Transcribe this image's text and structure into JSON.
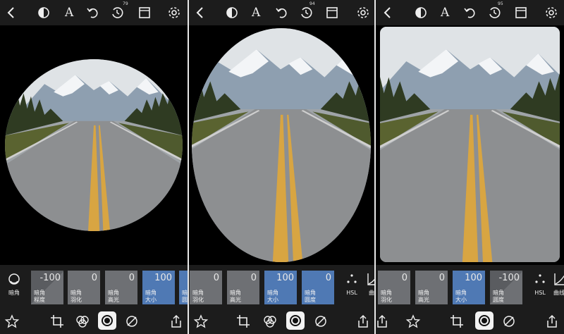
{
  "panels": [
    {
      "badge": "79",
      "text_tool": "A",
      "tiles": [
        {
          "value": "-100",
          "label1": "暗角",
          "label2": "程度"
        },
        {
          "value": "0",
          "label1": "暗角",
          "label2": "羽化"
        },
        {
          "value": "0",
          "label1": "暗角",
          "label2": "高光"
        },
        {
          "value": "100",
          "label1": "暗角",
          "label2": "大小"
        },
        {
          "value": "",
          "label1": "暗",
          "label2": "圆"
        }
      ],
      "tool_label": "暗角"
    },
    {
      "badge": "94",
      "text_tool": "A",
      "tiles": [
        {
          "value": "0",
          "label1": "暗角",
          "label2": "羽化"
        },
        {
          "value": "0",
          "label1": "暗角",
          "label2": "高光"
        },
        {
          "value": "100",
          "label1": "暗角",
          "label2": "大小"
        },
        {
          "value": "0",
          "label1": "暗角",
          "label2": "圆度"
        }
      ],
      "tool_label": "HSL",
      "tool_label2": "曲"
    },
    {
      "badge": "95",
      "text_tool": "A",
      "tiles": [
        {
          "value": "0",
          "label1": "暗角",
          "label2": "羽化"
        },
        {
          "value": "0",
          "label1": "暗角",
          "label2": "高光"
        },
        {
          "value": "100",
          "label1": "暗角",
          "label2": "大小"
        },
        {
          "value": "-100",
          "label1": "暗角",
          "label2": "圆度"
        }
      ],
      "tool_label": "HSL",
      "tool_label2": "曲线"
    }
  ],
  "icons": {
    "back": "chevron-left-icon",
    "mask": "mask-icon",
    "text": "text-icon",
    "undo": "undo-icon",
    "history": "history-icon",
    "compare": "compare-icon",
    "settings": "gear-icon",
    "vignette": "vignette-icon",
    "hsl": "dots-icon",
    "curve": "curve-icon",
    "star": "star-icon",
    "crop": "crop-icon",
    "blend": "blend-icon",
    "retouch": "retouch-icon",
    "share": "share-icon"
  },
  "colors": {
    "tile": "#6e7074",
    "tile_active": "#4f79b4",
    "background": "#1c1c1c"
  }
}
